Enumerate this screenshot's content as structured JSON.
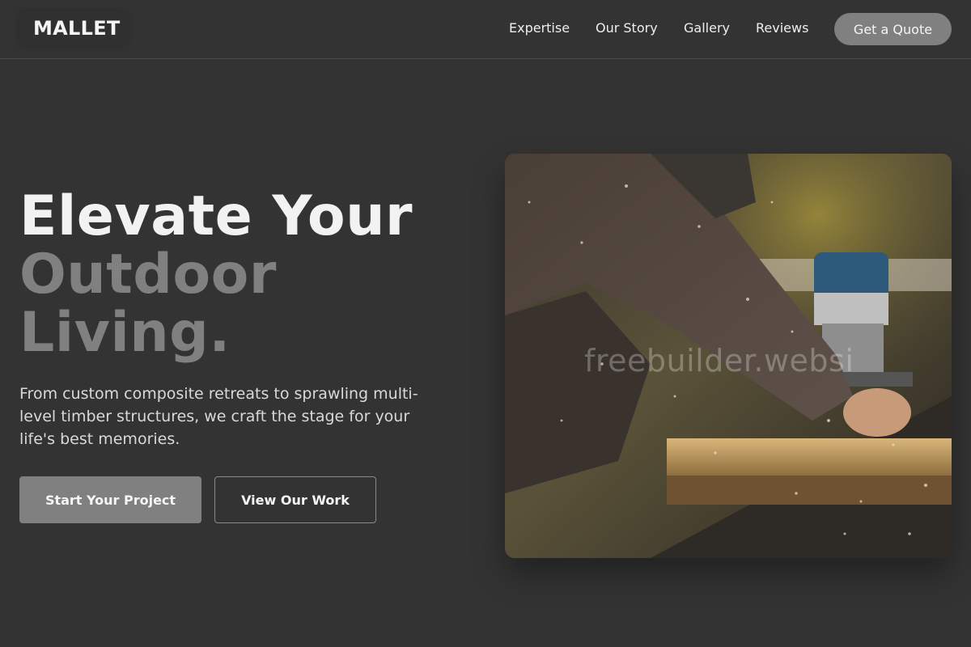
{
  "header": {
    "logo": "MALLET",
    "nav": [
      "Expertise",
      "Our Story",
      "Gallery",
      "Reviews"
    ],
    "cta": "Get a Quote"
  },
  "hero": {
    "headline_line1": "Elevate Your",
    "headline_line2": "Outdoor",
    "headline_line3": "Living.",
    "subtext": "From custom composite retreats to sprawling multi-level timber structures, we craft the stage for your life's best memories.",
    "primary_button": "Start Your Project",
    "secondary_button": "View Our Work",
    "image_watermark": "freebuilder.websi"
  },
  "colors": {
    "background": "#333333",
    "accent_gray": "#808080",
    "text_light": "#f2f2f2"
  }
}
